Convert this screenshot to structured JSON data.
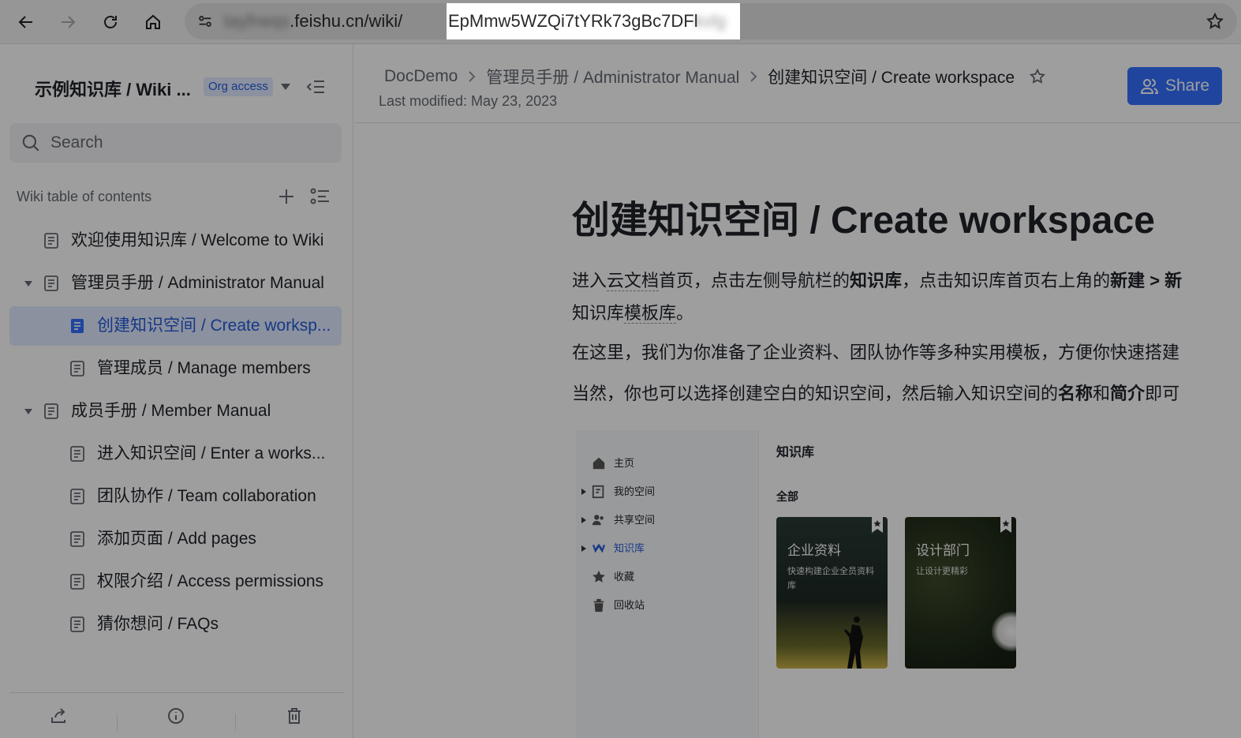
{
  "browser": {
    "url_domain": ".feishu.cn/wiki/",
    "url_path_visible": "EpMmw5WZQi7tYRk73gBc7DFl",
    "icons": [
      "back-arrow-icon",
      "forward-arrow-icon",
      "reload-icon",
      "home-icon",
      "site-info-icon",
      "bookmark-star-icon"
    ]
  },
  "sidebar": {
    "title": "示例知识库 / Wiki ...",
    "badge": "Org access",
    "search_placeholder": "Search",
    "toc_label": "Wiki table of contents",
    "items": [
      {
        "label": "欢迎使用知识库 / Welcome to Wiki"
      },
      {
        "label": "管理员手册 / Administrator Manual"
      },
      {
        "label": "创建知识空间 / Create worksp..."
      },
      {
        "label": "管理成员 / Manage members"
      },
      {
        "label": "成员手册 / Member Manual"
      },
      {
        "label": "进入知识空间 / Enter a works..."
      },
      {
        "label": "团队协作 / Team collaboration"
      },
      {
        "label": "添加页面 / Add pages"
      },
      {
        "label": "权限介绍 / Access permissions"
      },
      {
        "label": "猜你想问 / FAQs"
      }
    ]
  },
  "header": {
    "breadcrumbs": [
      "DocDemo",
      "管理员手册 / Administrator Manual",
      "创建知识空间 / Create workspace"
    ],
    "last_modified": "Last modified: May 23, 2023",
    "share_label": "Share"
  },
  "doc": {
    "title": "创建知识空间 / Create workspace",
    "p1_a": "进入",
    "p1_b": "云文档",
    "p1_c": "首页，点击左侧导航栏的",
    "p1_d": "知识库",
    "p1_e": "，点击知识库首页右上角的",
    "p1_f": "新建",
    "p1_g": " > 新",
    "p1_line2_a": "知识库",
    "p1_line2_b": "模板库",
    "p1_line2_c": "。",
    "p2": "在这里，我们为你准备了企业资料、团队协作等多种实用模板，方便你快速搭建",
    "p3_a": "当然，你也可以选择创建空白的知识空间，然后输入知识空间的",
    "p3_b": "名称",
    "p3_c": "和",
    "p3_d": "简介",
    "p3_e": "即可"
  },
  "embed": {
    "nav": [
      {
        "label": "主页",
        "icon": "home-icon"
      },
      {
        "label": "我的空间",
        "icon": "my-space-icon"
      },
      {
        "label": "共享空间",
        "icon": "shared-space-icon"
      },
      {
        "label": "知识库",
        "icon": "wiki-logo-icon"
      },
      {
        "label": "收藏",
        "icon": "star-icon"
      },
      {
        "label": "回收站",
        "icon": "trash-icon"
      }
    ],
    "heading": "知识库",
    "all_label": "全部",
    "cards": [
      {
        "title": "企业资料",
        "subtitle": "快速构建企业全员资料库"
      },
      {
        "title": "设计部门",
        "subtitle": "让设计更精彩"
      }
    ]
  }
}
